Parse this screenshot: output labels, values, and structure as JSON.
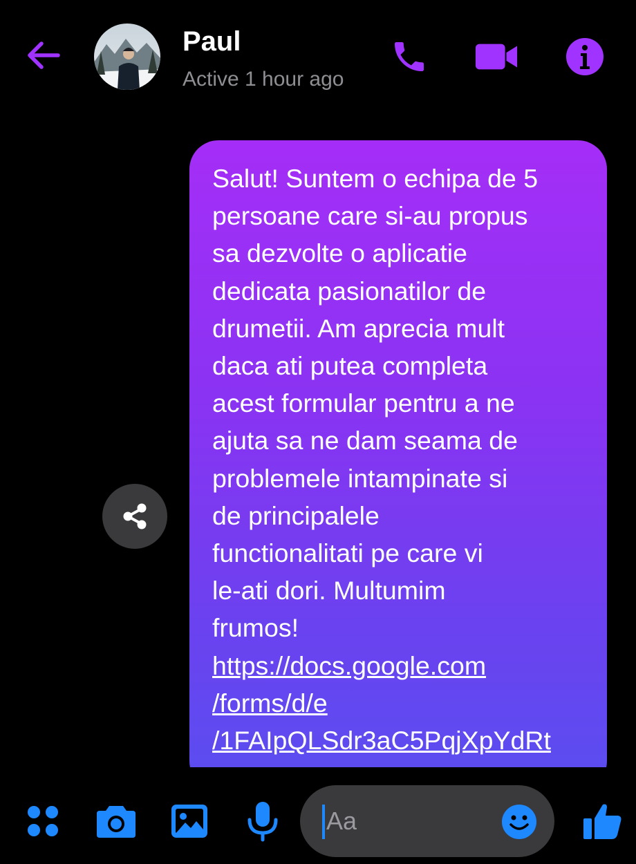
{
  "colors": {
    "accent": "#a033ff",
    "composer_accent": "#1e88ff",
    "status_gray": "#8e8e93",
    "input_bg": "#3a3a3c"
  },
  "header": {
    "back_icon": "back-arrow-icon",
    "contact_name": "Paul",
    "status": "Active 1 hour ago",
    "actions": [
      "phone-icon",
      "video-camera-icon",
      "info-icon"
    ]
  },
  "message": {
    "text": "Salut! Suntem o echipa de 5\npersoane care si-au propus\nsa dezvolte o aplicatie\ndedicata pasionatilor de\ndrumetii. Am aprecia mult\ndaca ati putea completa\nacest formular pentru a ne\najuta sa ne dam seama de\nproblemele intampinate si\nde principalele\nfunctionalitati pe care vi\nle-ati dori. Multumim\nfrumos!",
    "link": "https://docs.google.com\n/forms/d/e\n/1FAIpQLSdr3aC5PqjXpYdRt"
  },
  "composer": {
    "placeholder": "Aa",
    "icons": [
      "menu-dots-icon",
      "camera-icon",
      "image-icon",
      "microphone-icon",
      "emoji-icon",
      "thumbs-up-icon"
    ]
  }
}
